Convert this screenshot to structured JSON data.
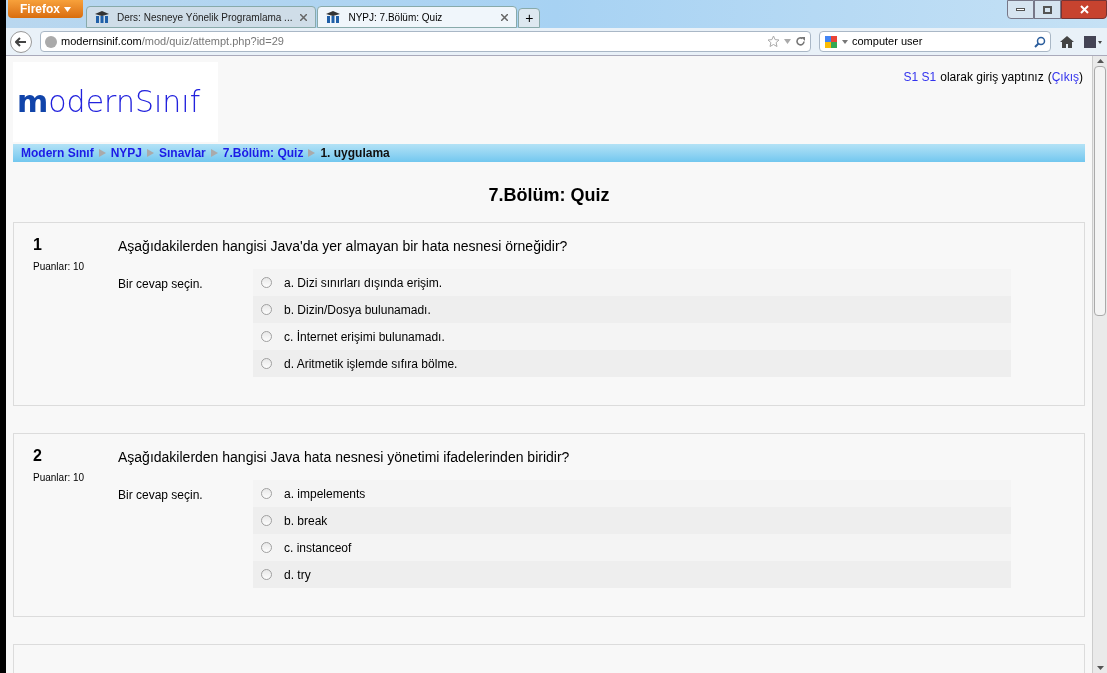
{
  "browser": {
    "menu_button": "Firefox",
    "tabs": [
      {
        "title": "Ders: Nesneye Yönelik Programlama ...",
        "selected": false
      },
      {
        "title": "NYPJ: 7.Bölüm: Quiz",
        "selected": true
      }
    ],
    "new_tab": "+",
    "address": {
      "domain": "modernsinif.com",
      "path": "/mod/quiz/attempt.php?id=29"
    },
    "search": {
      "value": "computer user"
    }
  },
  "page": {
    "logo": {
      "first": "m",
      "rest": "odernSınıf"
    },
    "login": {
      "user": "S1 S1",
      "text": "olarak giriş yaptınız",
      "open": "(",
      "logout": "Çıkış",
      "close": ")"
    },
    "breadcrumb": [
      {
        "label": "Modern Sınıf",
        "link": true
      },
      {
        "label": "NYPJ",
        "link": true
      },
      {
        "label": "Sınavlar",
        "link": true
      },
      {
        "label": "7.Bölüm: Quiz",
        "link": true
      },
      {
        "label": "1. uygulama",
        "link": false
      }
    ],
    "title": "7.Bölüm: Quiz",
    "questions": [
      {
        "number": "1",
        "points": "Puanlar: 10",
        "text": "Aşağıdakilerden hangisi Java'da yer almayan bir hata nesnesi örneğidir?",
        "prompt": "Bir cevap seçin.",
        "options": [
          {
            "label": "a. Dizi sınırları dışında erişim.",
            "selected": false
          },
          {
            "label": "b. Dizin/Dosya bulunamadı.",
            "selected": false
          },
          {
            "label": "c. İnternet erişimi bulunamadı.",
            "selected": false
          },
          {
            "label": "d. Aritmetik işlemde sıfıra bölme.",
            "selected": false
          }
        ]
      },
      {
        "number": "2",
        "points": "Puanlar: 10",
        "text": "Aşağıdakilerden hangisi Java hata nesnesi yönetimi ifadelerinden biridir?",
        "prompt": "Bir cevap seçin.",
        "options": [
          {
            "label": "a. impelements",
            "selected": false
          },
          {
            "label": "b. break",
            "selected": false
          },
          {
            "label": "c. instanceof",
            "selected": false
          },
          {
            "label": "d. try",
            "selected": false
          }
        ]
      }
    ]
  }
}
